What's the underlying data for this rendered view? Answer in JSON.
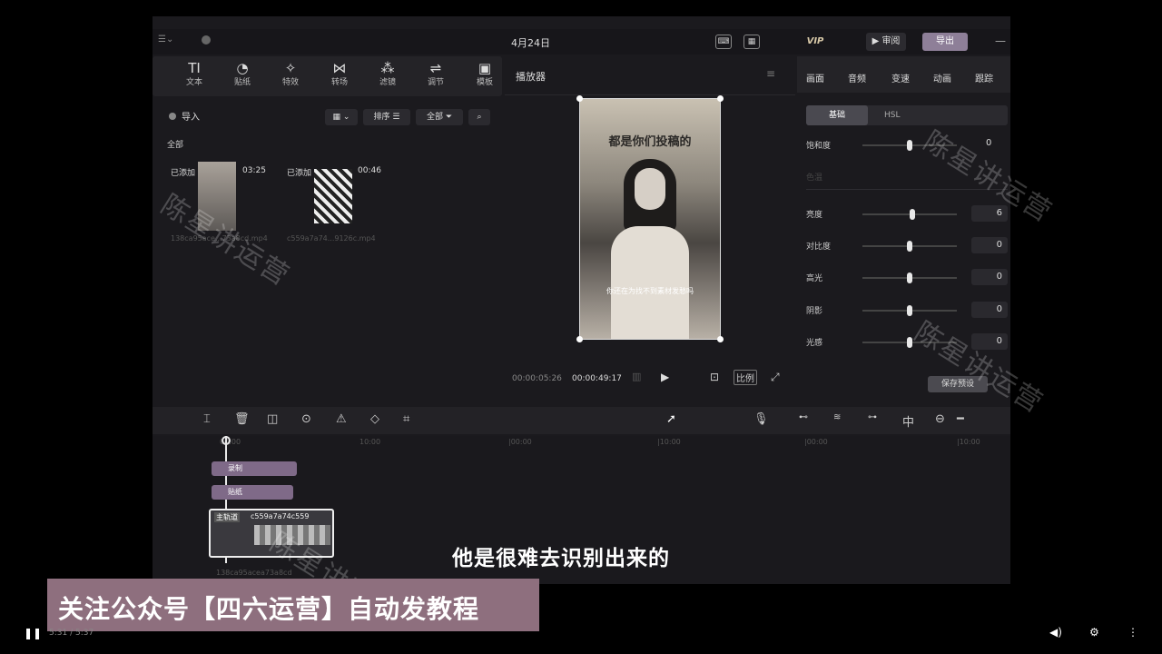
{
  "titlebar": {
    "date": "4月24日",
    "vip": "VIP",
    "share": "审阅",
    "export": "导出"
  },
  "toolbar": [
    {
      "icon": "text-icon",
      "glyph": "TI",
      "label": "文本"
    },
    {
      "icon": "sticker-icon",
      "glyph": "◔",
      "label": "贴纸"
    },
    {
      "icon": "effects-icon",
      "glyph": "✧",
      "label": "特效"
    },
    {
      "icon": "transition-icon",
      "glyph": "⋈",
      "label": "转场"
    },
    {
      "icon": "filter-icon",
      "glyph": "⁂",
      "label": "滤镜"
    },
    {
      "icon": "adjust-icon",
      "glyph": "⇌",
      "label": "调节"
    },
    {
      "icon": "template-icon",
      "glyph": "▣",
      "label": "模板"
    }
  ],
  "media": {
    "import": "导入",
    "sort": "排序",
    "all": "全部",
    "section": "全部",
    "clips": [
      {
        "status": "已添加",
        "duration": "03:25",
        "name": "138ca95ace...73a8cd.mp4"
      },
      {
        "status": "已添加",
        "duration": "00:46",
        "name": "c559a7a74...9126c.mp4"
      }
    ]
  },
  "player": {
    "title": "播放器",
    "current": "00:00:05:26",
    "total": "00:00:49:17",
    "ratio": "比例",
    "video_caption": "都是你们投稿的",
    "video_subcaption": "你还在为找不到素材发愁吗"
  },
  "inspector": {
    "tabs": [
      "画面",
      "音频",
      "变速",
      "动画",
      "跟踪"
    ],
    "subtabs": [
      "基础",
      "HSL"
    ],
    "rows": [
      {
        "label": "饱和度",
        "value": "0",
        "level": 0.5
      },
      {
        "label": "亮度",
        "value": "6",
        "level": 0.53
      },
      {
        "label": "对比度",
        "value": "0",
        "level": 0.5
      },
      {
        "label": "高光",
        "value": "0",
        "level": 0.5
      },
      {
        "label": "阴影",
        "value": "0",
        "level": 0.5
      },
      {
        "label": "光感",
        "value": "0",
        "level": 0.5
      }
    ],
    "section_label": "色温",
    "save_preset": "保存预设"
  },
  "timeline": {
    "ticks": [
      "00:00",
      "10:00",
      "|00:00",
      "|10:00",
      "|00:00",
      "|10:00"
    ],
    "tracks": [
      {
        "label": "录制"
      },
      {
        "label": "贴纸"
      }
    ],
    "main_clip": {
      "label": "主轨道",
      "name": "c559a7a74c559",
      "sub": "138ca95acea73a8cd"
    }
  },
  "overlay": {
    "watermark": "陈星讲运营",
    "subtitle": "他是很难去识别出来的",
    "banner": "关注公众号【四六运营】自动发教程"
  },
  "player_bar": {
    "time": "5:31 / 5:37"
  },
  "colors": {
    "banner": "#8e6f7e",
    "track": "#7f6a88",
    "app_bg": "#1b1a1e"
  }
}
